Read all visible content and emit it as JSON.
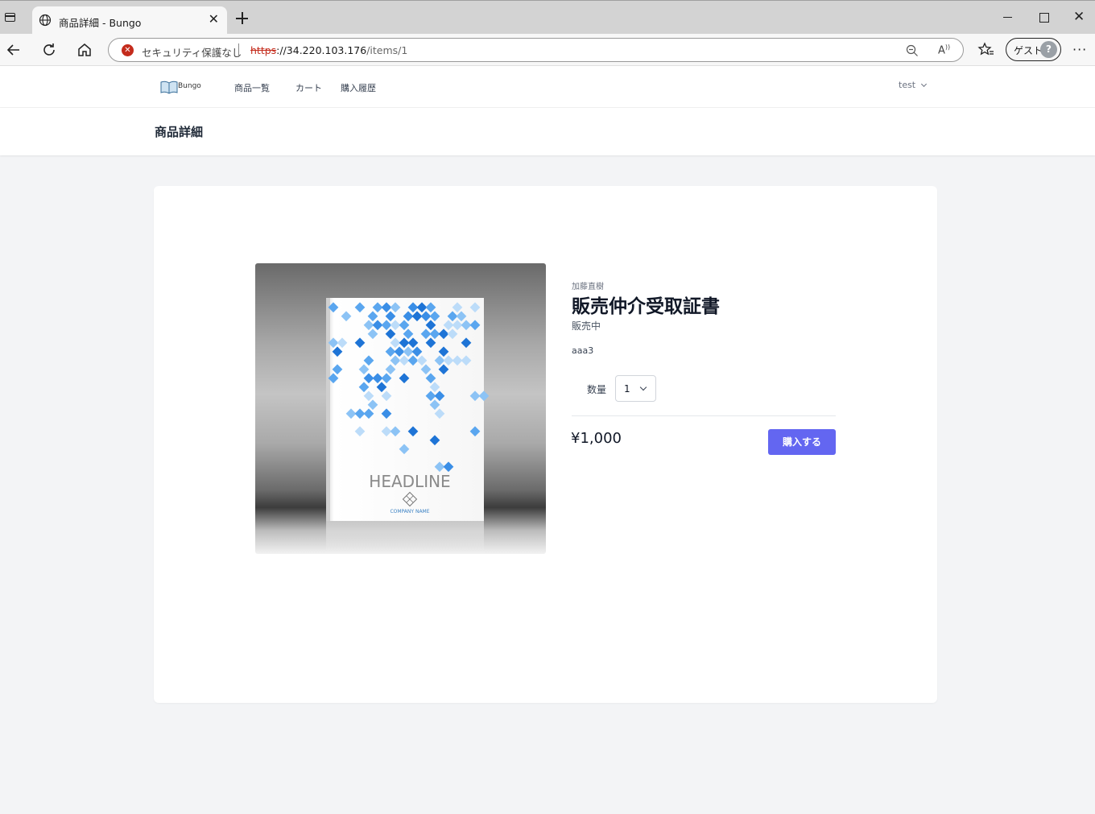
{
  "browser": {
    "tab_title": "商品詳細 - Bungo",
    "tab_close": "✕",
    "security_text": "セキュリティ保護なし",
    "url_protocol": "https",
    "url_host": "://34.220.103.176",
    "url_path": "/items/1",
    "guest_label": "ゲスト",
    "window_close": "✕",
    "more": "···"
  },
  "site": {
    "logo_text": "Bungo",
    "nav": [
      "商品一覧",
      "カート",
      "購入履歴"
    ],
    "user_name": "test"
  },
  "page": {
    "title": "商品詳細"
  },
  "product": {
    "author": "加藤直樹",
    "name": "販売仲介受取証書",
    "status": "販売中",
    "description": "aaa3",
    "quantity_label": "数量",
    "quantity_value": "1",
    "price": "¥1,000",
    "buy_label": "購入する",
    "cover_headline": "HEADLINE",
    "cover_company": "COMPANY NAME"
  },
  "colors": {
    "accent": "#6366f1",
    "security_warning": "#c42b1c",
    "page_bg": "#f3f4f6"
  }
}
